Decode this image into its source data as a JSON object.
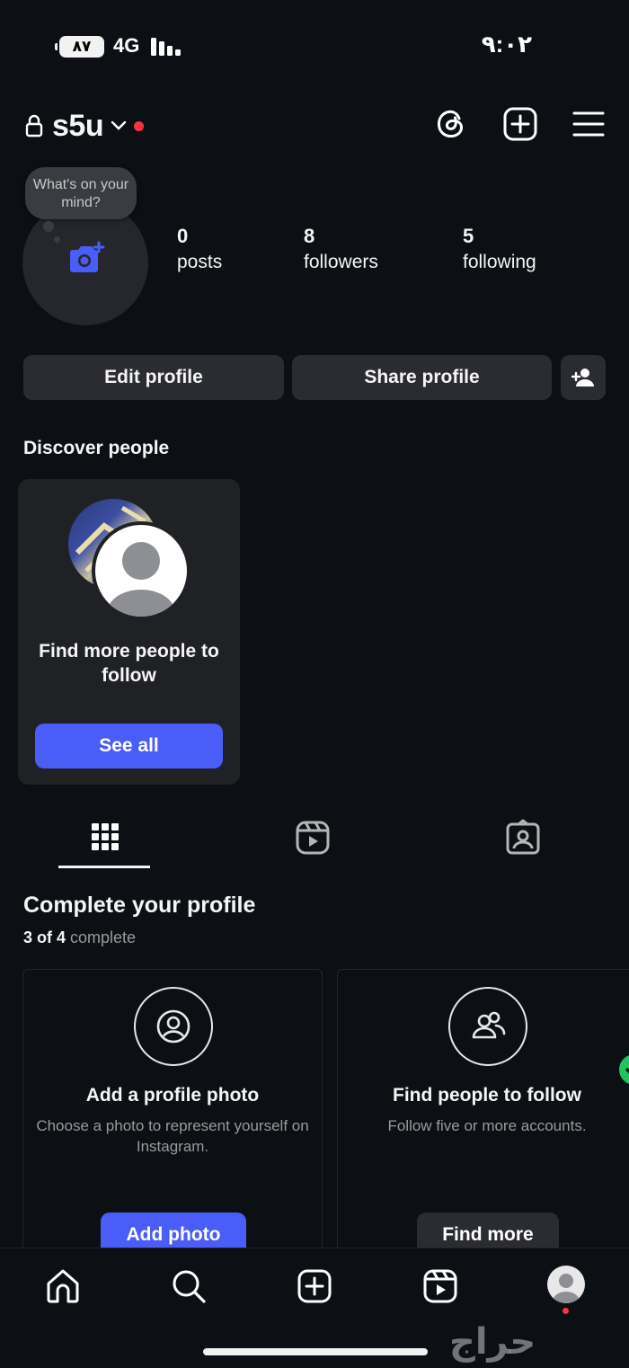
{
  "status_bar": {
    "battery": "٨٧",
    "network": "4G",
    "time": "٩:٠٢"
  },
  "header": {
    "username": "s5u",
    "icons": [
      "lock-icon",
      "chevron-down-icon",
      "threads-icon",
      "create-plus-icon",
      "menu-icon"
    ],
    "notification_dot_color": "#ff3040"
  },
  "profile": {
    "note": "What's on your mind?",
    "stats": [
      {
        "value": "0",
        "label": "posts"
      },
      {
        "value": "8",
        "label": "followers"
      },
      {
        "value": "5",
        "label": "following"
      }
    ],
    "edit_button": "Edit profile",
    "share_button": "Share profile"
  },
  "discover": {
    "title": "Discover people",
    "card_text": "Find more people to follow",
    "see_all": "See all",
    "accent": "#4a5df9"
  },
  "tabs": [
    "grid-icon",
    "reels-icon",
    "tagged-icon"
  ],
  "complete_profile": {
    "title": "Complete your profile",
    "progress_bold": "3 of 4",
    "progress_rest": "complete",
    "cards": [
      {
        "title": "Add a profile photo",
        "description": "Choose a photo to represent yourself on Instagram.",
        "button": "Add photo",
        "icon": "user-circle-icon"
      },
      {
        "title": "Find people to follow",
        "description": "Follow five or more accounts.",
        "button": "Find more",
        "icon": "people-icon",
        "completed": true
      }
    ]
  },
  "bottom_nav": [
    "home-icon",
    "search-icon",
    "create-icon",
    "reels-icon",
    "profile-avatar"
  ],
  "watermark": "حراج"
}
